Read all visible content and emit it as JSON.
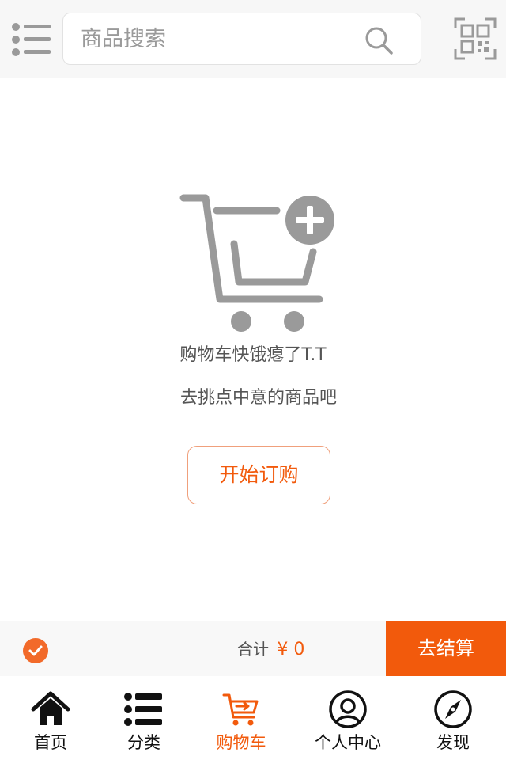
{
  "header": {
    "search_placeholder": "商品搜索",
    "menu_icon": "list-menu-icon",
    "search_icon": "search-icon",
    "qr_icon": "qr-scan-icon"
  },
  "empty_state": {
    "icon": "cart-add-icon",
    "message_primary": "购物车快饿瘪了T.T",
    "message_secondary": "去挑点中意的商品吧",
    "start_button": "开始订购"
  },
  "checkout": {
    "total_label": "合计",
    "total_amount": "¥ 0",
    "checkout_button": "去结算"
  },
  "tabs": [
    {
      "label": "首页",
      "icon": "home-icon"
    },
    {
      "label": "分类",
      "icon": "category-list-icon"
    },
    {
      "label": "购物车",
      "icon": "cart-icon",
      "active": true
    },
    {
      "label": "个人中心",
      "icon": "user-center-icon"
    },
    {
      "label": "发现",
      "icon": "compass-icon"
    }
  ],
  "colors": {
    "accent": "#f25a0c",
    "icon_gray": "#9a9a9a",
    "header_bg": "#f7f7f7"
  }
}
